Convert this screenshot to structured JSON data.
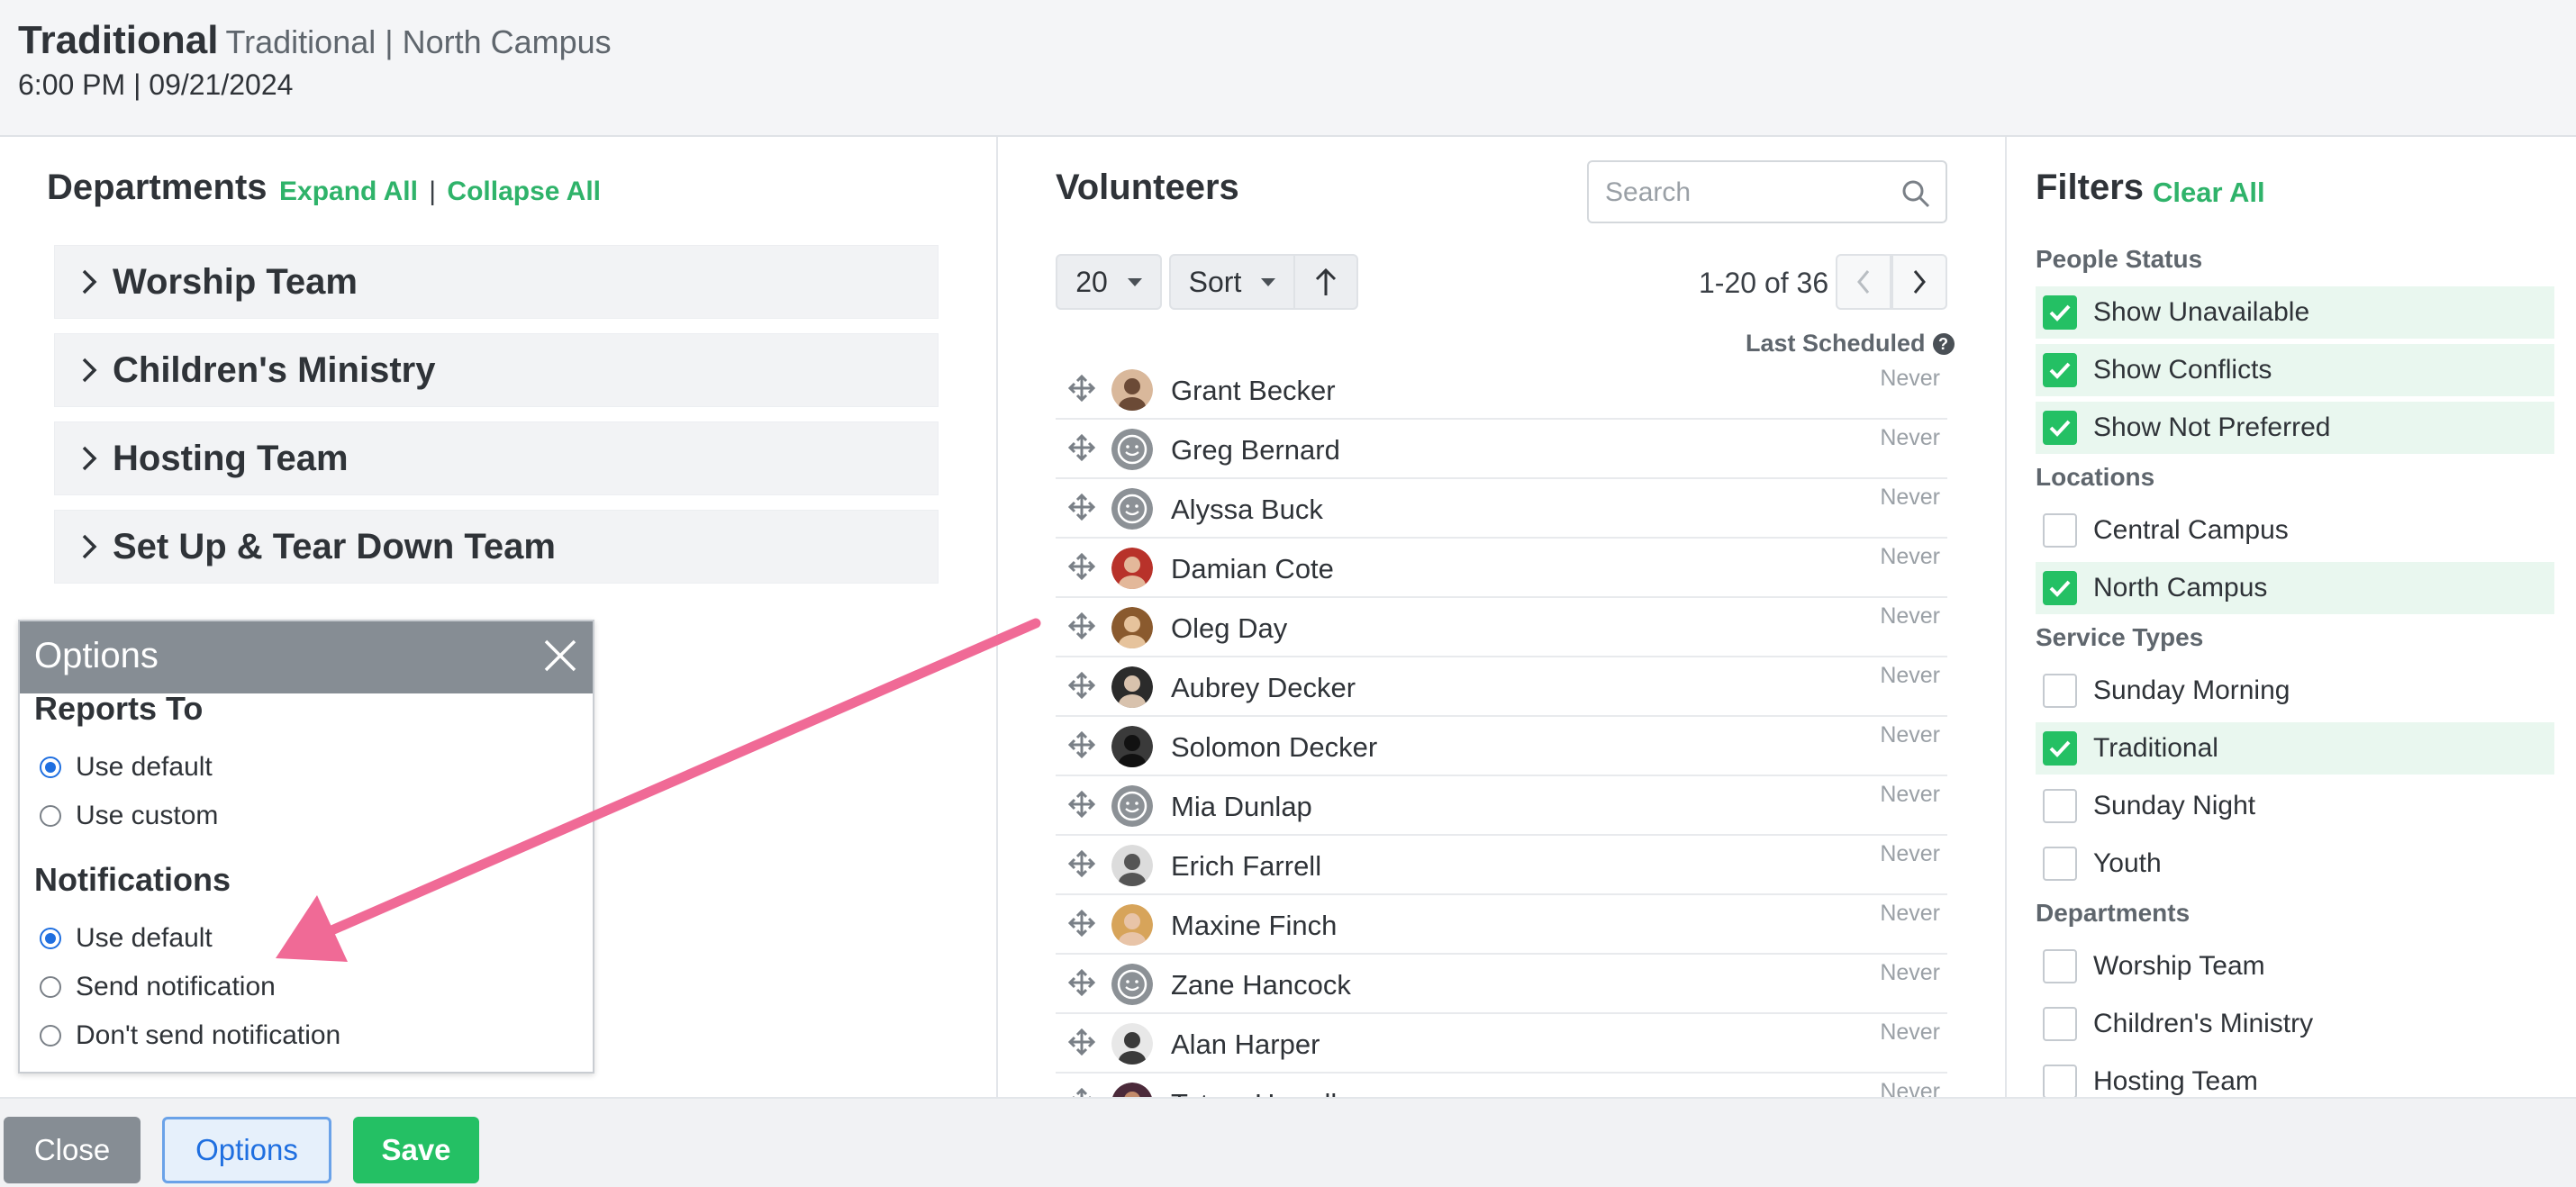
{
  "header": {
    "title": "Traditional",
    "subtitle": "Traditional | North Campus",
    "datetime": "6:00 PM | 09/21/2024"
  },
  "departments": {
    "title": "Departments",
    "expand_all": "Expand All",
    "separator": "|",
    "collapse_all": "Collapse All",
    "items": [
      "Worship Team",
      "Children's Ministry",
      "Hosting Team",
      "Set Up & Tear Down Team"
    ]
  },
  "options_popup": {
    "title": "Options",
    "reports_to": {
      "heading": "Reports To",
      "options": [
        {
          "label": "Use default",
          "selected": true
        },
        {
          "label": "Use custom",
          "selected": false
        }
      ]
    },
    "notifications": {
      "heading": "Notifications",
      "options": [
        {
          "label": "Use default",
          "selected": true
        },
        {
          "label": "Send notification",
          "selected": false
        },
        {
          "label": "Don't send notification",
          "selected": false
        }
      ]
    }
  },
  "volunteers": {
    "title": "Volunteers",
    "search_placeholder": "Search",
    "page_size": "20",
    "sort_label": "Sort",
    "pager_text": "1-20 of 36",
    "last_scheduled_label": "Last Scheduled",
    "rows": [
      {
        "name": "Grant Becker",
        "last": "Never",
        "avatar": "photo-bald-man"
      },
      {
        "name": "Greg Bernard",
        "last": "Never",
        "avatar": "placeholder"
      },
      {
        "name": "Alyssa Buck",
        "last": "Never",
        "avatar": "placeholder"
      },
      {
        "name": "Damian Cote",
        "last": "Never",
        "avatar": "photo-red"
      },
      {
        "name": "Oleg Day",
        "last": "Never",
        "avatar": "photo-curly"
      },
      {
        "name": "Aubrey Decker",
        "last": "Never",
        "avatar": "photo-dark-hair"
      },
      {
        "name": "Solomon Decker",
        "last": "Never",
        "avatar": "photo-sunglasses"
      },
      {
        "name": "Mia Dunlap",
        "last": "Never",
        "avatar": "placeholder"
      },
      {
        "name": "Erich Farrell",
        "last": "Never",
        "avatar": "photo-bw"
      },
      {
        "name": "Maxine Finch",
        "last": "Never",
        "avatar": "photo-blonde"
      },
      {
        "name": "Zane Hancock",
        "last": "Never",
        "avatar": "placeholder"
      },
      {
        "name": "Alan Harper",
        "last": "Never",
        "avatar": "photo-bw-hat"
      },
      {
        "name": "Tatum Herrell",
        "last": "Never",
        "avatar": "photo-dark"
      }
    ]
  },
  "filters": {
    "title": "Filters",
    "clear_all": "Clear All",
    "groups": [
      {
        "heading": "People Status",
        "items": [
          {
            "label": "Show Unavailable",
            "checked": true
          },
          {
            "label": "Show Conflicts",
            "checked": true
          },
          {
            "label": "Show Not Preferred",
            "checked": true
          }
        ]
      },
      {
        "heading": "Locations",
        "items": [
          {
            "label": "Central Campus",
            "checked": false
          },
          {
            "label": "North Campus",
            "checked": true
          }
        ]
      },
      {
        "heading": "Service Types",
        "items": [
          {
            "label": "Sunday Morning",
            "checked": false
          },
          {
            "label": "Traditional",
            "checked": true
          },
          {
            "label": "Sunday Night",
            "checked": false
          },
          {
            "label": "Youth",
            "checked": false
          }
        ]
      },
      {
        "heading": "Departments",
        "items": [
          {
            "label": "Worship Team",
            "checked": false
          },
          {
            "label": "Children's Ministry",
            "checked": false
          },
          {
            "label": "Hosting Team",
            "checked": false
          }
        ]
      }
    ]
  },
  "footer": {
    "close": "Close",
    "options": "Options",
    "save": "Save"
  },
  "colors": {
    "accent_green": "#24c064",
    "link_green": "#2fb36a",
    "radio_blue": "#1f6fe0",
    "annotation_arrow": "#f06a96",
    "popup_bar": "#868d94"
  }
}
